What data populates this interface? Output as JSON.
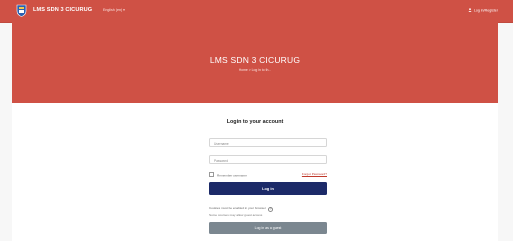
{
  "navbar": {
    "brand": "LMS SDN 3 CICURUG",
    "language": "English (en) ▾",
    "login_link": "Log in/Register",
    "logo_icon": "school-logo-icon",
    "login_icon": "person-icon"
  },
  "hero": {
    "title": "LMS SDN 3 CICURUG",
    "breadcrumb": "Home > Log in to th..."
  },
  "login": {
    "title": "Login to your account",
    "username_placeholder": "Username",
    "password_placeholder": "Password",
    "remember_label": "Remember username",
    "forgot_label": "Forgot Password?",
    "login_button": "Log in",
    "cookies_notice": "Cookies must be enabled in your browser",
    "cookies_help_icon": "question-circle-icon",
    "guest_note": "Some courses may allow guest access",
    "guest_button": "Log in as a guest"
  },
  "colors": {
    "brand_red": "#cf5145",
    "login_button": "#1c2a68",
    "guest_button": "#7b8790",
    "link_red": "#c0392b"
  }
}
